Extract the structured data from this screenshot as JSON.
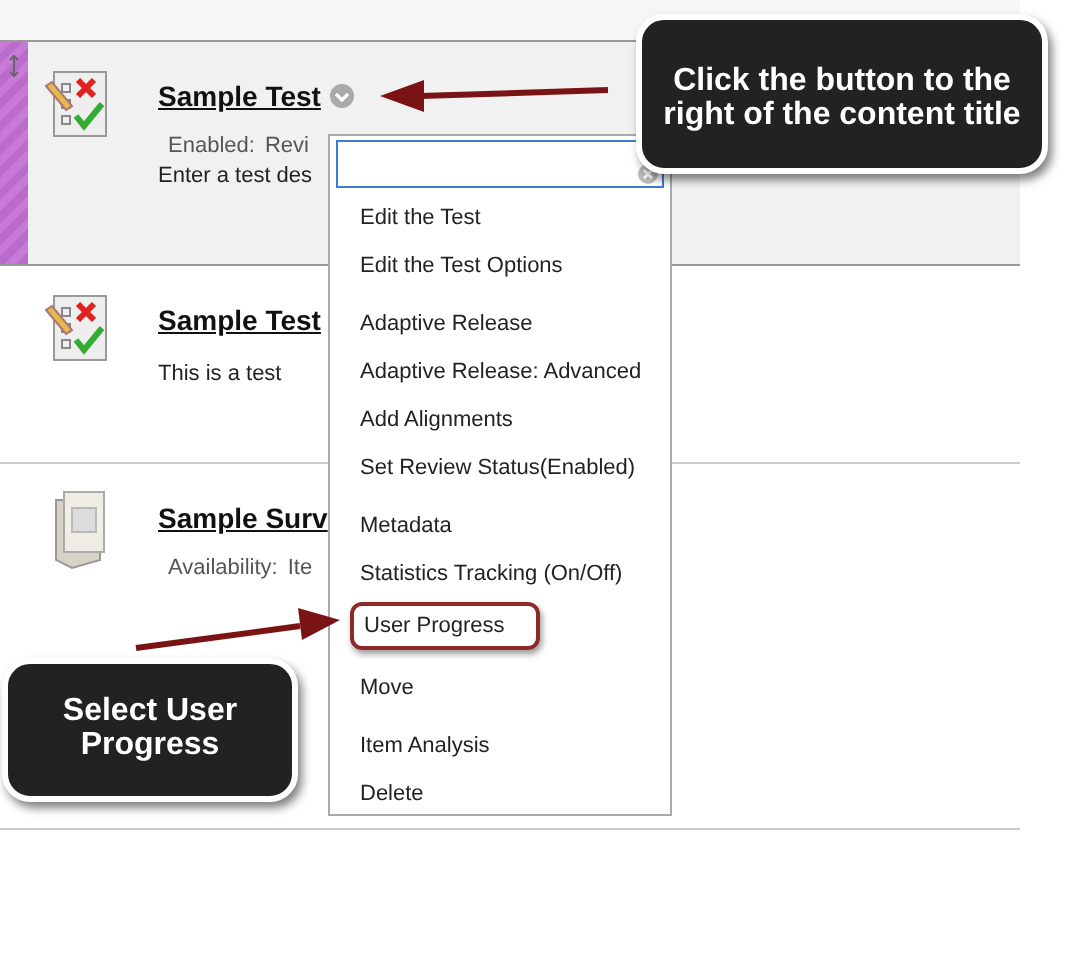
{
  "items": [
    {
      "kind": "test",
      "title": "Sample Test",
      "has_menu_button": true,
      "selected": true,
      "details": [
        {
          "label": "Enabled:",
          "value": "Revi"
        }
      ],
      "description": "Enter a test des"
    },
    {
      "kind": "test",
      "title": "Sample Test",
      "has_menu_button": false,
      "selected": false,
      "description": "This is a test"
    },
    {
      "kind": "survey",
      "title": "Sample Surv",
      "has_menu_button": false,
      "selected": false,
      "details": [
        {
          "label": "Availability:",
          "value": "Ite"
        }
      ]
    }
  ],
  "menu": {
    "groups": [
      [
        {
          "label": "Edit the Test",
          "highlighted": false
        },
        {
          "label": "Edit the Test Options",
          "highlighted": false
        }
      ],
      [
        {
          "label": "Adaptive Release",
          "highlighted": false
        },
        {
          "label": "Adaptive Release: Advanced",
          "highlighted": false
        },
        {
          "label": "Add Alignments",
          "highlighted": false
        },
        {
          "label": "Set Review Status(Enabled)",
          "highlighted": false
        }
      ],
      [
        {
          "label": "Metadata",
          "highlighted": false
        },
        {
          "label": "Statistics Tracking (On/Off)",
          "highlighted": false
        },
        {
          "label": "User Progress",
          "highlighted": true
        }
      ],
      [
        {
          "label": "Move",
          "highlighted": false
        }
      ],
      [
        {
          "label": "Item Analysis",
          "highlighted": false
        },
        {
          "label": "Delete",
          "highlighted": false
        }
      ]
    ]
  },
  "callouts": [
    {
      "text": "Click the button to the right of the content title"
    },
    {
      "text": "Select User Progress"
    }
  ]
}
